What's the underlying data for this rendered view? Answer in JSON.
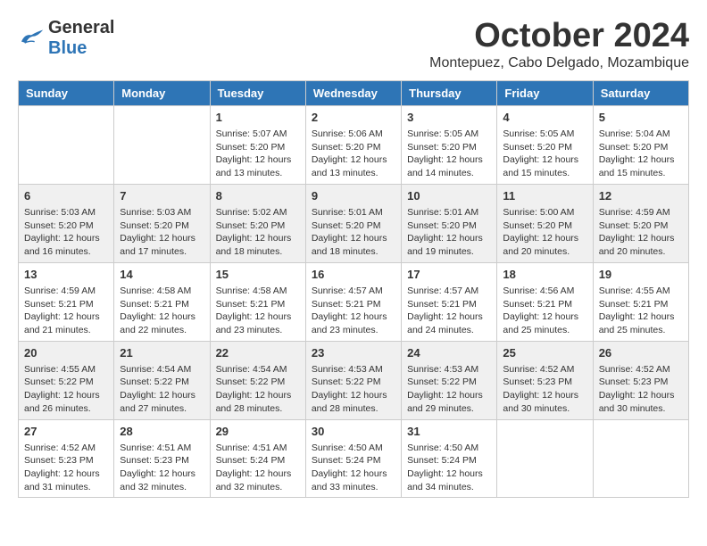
{
  "header": {
    "logo_line1": "General",
    "logo_line2": "Blue",
    "month_title": "October 2024",
    "subtitle": "Montepuez, Cabo Delgado, Mozambique"
  },
  "weekdays": [
    "Sunday",
    "Monday",
    "Tuesday",
    "Wednesday",
    "Thursday",
    "Friday",
    "Saturday"
  ],
  "weeks": [
    [
      {
        "day": "",
        "info": ""
      },
      {
        "day": "",
        "info": ""
      },
      {
        "day": "1",
        "info": "Sunrise: 5:07 AM\nSunset: 5:20 PM\nDaylight: 12 hours and 13 minutes."
      },
      {
        "day": "2",
        "info": "Sunrise: 5:06 AM\nSunset: 5:20 PM\nDaylight: 12 hours and 13 minutes."
      },
      {
        "day": "3",
        "info": "Sunrise: 5:05 AM\nSunset: 5:20 PM\nDaylight: 12 hours and 14 minutes."
      },
      {
        "day": "4",
        "info": "Sunrise: 5:05 AM\nSunset: 5:20 PM\nDaylight: 12 hours and 15 minutes."
      },
      {
        "day": "5",
        "info": "Sunrise: 5:04 AM\nSunset: 5:20 PM\nDaylight: 12 hours and 15 minutes."
      }
    ],
    [
      {
        "day": "6",
        "info": "Sunrise: 5:03 AM\nSunset: 5:20 PM\nDaylight: 12 hours and 16 minutes."
      },
      {
        "day": "7",
        "info": "Sunrise: 5:03 AM\nSunset: 5:20 PM\nDaylight: 12 hours and 17 minutes."
      },
      {
        "day": "8",
        "info": "Sunrise: 5:02 AM\nSunset: 5:20 PM\nDaylight: 12 hours and 18 minutes."
      },
      {
        "day": "9",
        "info": "Sunrise: 5:01 AM\nSunset: 5:20 PM\nDaylight: 12 hours and 18 minutes."
      },
      {
        "day": "10",
        "info": "Sunrise: 5:01 AM\nSunset: 5:20 PM\nDaylight: 12 hours and 19 minutes."
      },
      {
        "day": "11",
        "info": "Sunrise: 5:00 AM\nSunset: 5:20 PM\nDaylight: 12 hours and 20 minutes."
      },
      {
        "day": "12",
        "info": "Sunrise: 4:59 AM\nSunset: 5:20 PM\nDaylight: 12 hours and 20 minutes."
      }
    ],
    [
      {
        "day": "13",
        "info": "Sunrise: 4:59 AM\nSunset: 5:21 PM\nDaylight: 12 hours and 21 minutes."
      },
      {
        "day": "14",
        "info": "Sunrise: 4:58 AM\nSunset: 5:21 PM\nDaylight: 12 hours and 22 minutes."
      },
      {
        "day": "15",
        "info": "Sunrise: 4:58 AM\nSunset: 5:21 PM\nDaylight: 12 hours and 23 minutes."
      },
      {
        "day": "16",
        "info": "Sunrise: 4:57 AM\nSunset: 5:21 PM\nDaylight: 12 hours and 23 minutes."
      },
      {
        "day": "17",
        "info": "Sunrise: 4:57 AM\nSunset: 5:21 PM\nDaylight: 12 hours and 24 minutes."
      },
      {
        "day": "18",
        "info": "Sunrise: 4:56 AM\nSunset: 5:21 PM\nDaylight: 12 hours and 25 minutes."
      },
      {
        "day": "19",
        "info": "Sunrise: 4:55 AM\nSunset: 5:21 PM\nDaylight: 12 hours and 25 minutes."
      }
    ],
    [
      {
        "day": "20",
        "info": "Sunrise: 4:55 AM\nSunset: 5:22 PM\nDaylight: 12 hours and 26 minutes."
      },
      {
        "day": "21",
        "info": "Sunrise: 4:54 AM\nSunset: 5:22 PM\nDaylight: 12 hours and 27 minutes."
      },
      {
        "day": "22",
        "info": "Sunrise: 4:54 AM\nSunset: 5:22 PM\nDaylight: 12 hours and 28 minutes."
      },
      {
        "day": "23",
        "info": "Sunrise: 4:53 AM\nSunset: 5:22 PM\nDaylight: 12 hours and 28 minutes."
      },
      {
        "day": "24",
        "info": "Sunrise: 4:53 AM\nSunset: 5:22 PM\nDaylight: 12 hours and 29 minutes."
      },
      {
        "day": "25",
        "info": "Sunrise: 4:52 AM\nSunset: 5:23 PM\nDaylight: 12 hours and 30 minutes."
      },
      {
        "day": "26",
        "info": "Sunrise: 4:52 AM\nSunset: 5:23 PM\nDaylight: 12 hours and 30 minutes."
      }
    ],
    [
      {
        "day": "27",
        "info": "Sunrise: 4:52 AM\nSunset: 5:23 PM\nDaylight: 12 hours and 31 minutes."
      },
      {
        "day": "28",
        "info": "Sunrise: 4:51 AM\nSunset: 5:23 PM\nDaylight: 12 hours and 32 minutes."
      },
      {
        "day": "29",
        "info": "Sunrise: 4:51 AM\nSunset: 5:24 PM\nDaylight: 12 hours and 32 minutes."
      },
      {
        "day": "30",
        "info": "Sunrise: 4:50 AM\nSunset: 5:24 PM\nDaylight: 12 hours and 33 minutes."
      },
      {
        "day": "31",
        "info": "Sunrise: 4:50 AM\nSunset: 5:24 PM\nDaylight: 12 hours and 34 minutes."
      },
      {
        "day": "",
        "info": ""
      },
      {
        "day": "",
        "info": ""
      }
    ]
  ]
}
